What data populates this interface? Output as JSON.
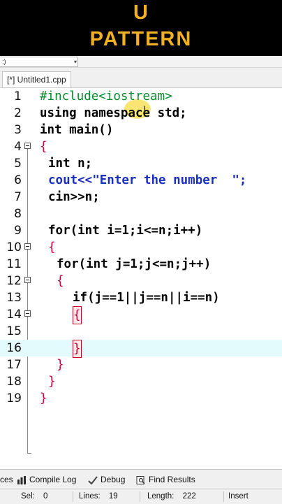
{
  "banner": {
    "line1": "U",
    "line2": "PATTERN",
    "color": "#f2b022"
  },
  "window": {
    "top_combo": ":)",
    "tab_label": "[*] Untitled1.cpp"
  },
  "code_lines": [
    {
      "n": "1",
      "text": "#include<iostream>"
    },
    {
      "n": "2",
      "text": "using namespace std;"
    },
    {
      "n": "3",
      "text": "int main()"
    },
    {
      "n": "4",
      "text": "{"
    },
    {
      "n": "5",
      "text": "int n;"
    },
    {
      "n": "6",
      "text": "cout<<\"Enter the number  \";"
    },
    {
      "n": "7",
      "text": "cin>>n;"
    },
    {
      "n": "8",
      "text": ""
    },
    {
      "n": "9",
      "text": "for(int i=1;i<=n;i++)"
    },
    {
      "n": "10",
      "text": "{"
    },
    {
      "n": "11",
      "text": "for(int j=1;j<=n;j++)"
    },
    {
      "n": "12",
      "text": "{"
    },
    {
      "n": "13",
      "text": "if(j==1||j==n||i==n)"
    },
    {
      "n": "14",
      "text": "{"
    },
    {
      "n": "15",
      "text": ""
    },
    {
      "n": "16",
      "text": "}"
    },
    {
      "n": "17",
      "text": "}"
    },
    {
      "n": "18",
      "text": "}"
    },
    {
      "n": "19",
      "text": "}"
    }
  ],
  "bottom_tabs": [
    {
      "label": "ces",
      "icon": "resources-icon"
    },
    {
      "label": "Compile Log",
      "icon": "bar-chart-icon"
    },
    {
      "label": "Debug",
      "icon": "checkmark-icon"
    },
    {
      "label": "Find Results",
      "icon": "find-icon"
    }
  ],
  "status": {
    "sel_label": "Sel:",
    "sel_value": "0",
    "lines_label": "Lines:",
    "lines_value": "19",
    "length_label": "Length:",
    "length_value": "222",
    "mode": "Insert"
  }
}
